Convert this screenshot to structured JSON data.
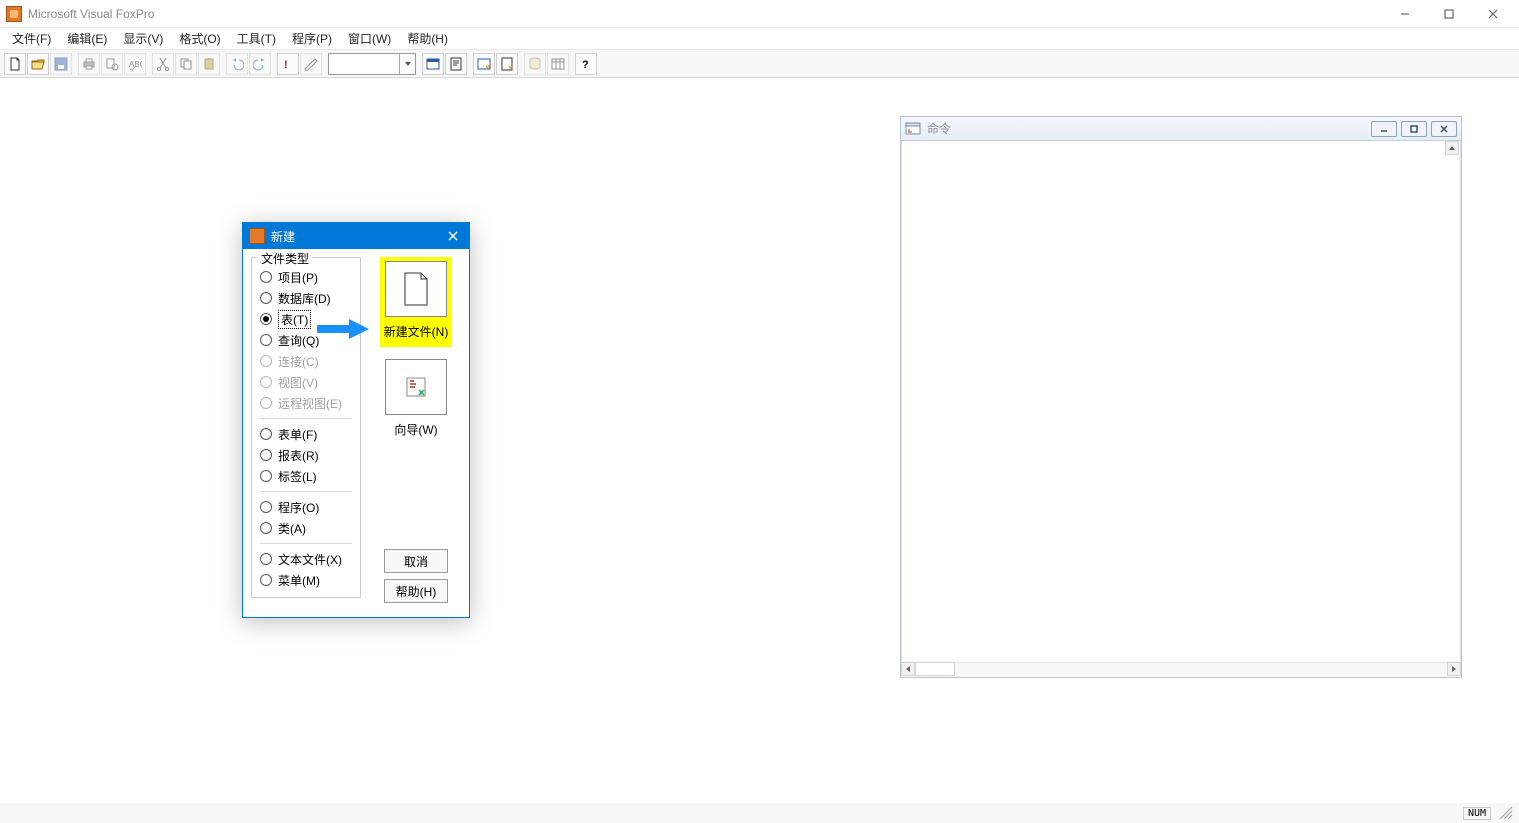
{
  "app": {
    "title": "Microsoft Visual FoxPro"
  },
  "menu": {
    "items": [
      "文件(F)",
      "编辑(E)",
      "显示(V)",
      "格式(O)",
      "工具(T)",
      "程序(P)",
      "窗口(W)",
      "帮助(H)"
    ]
  },
  "toolbar": {
    "buttons": [
      {
        "name": "new-file-icon",
        "title": "新建"
      },
      {
        "name": "open-icon",
        "title": "打开"
      },
      {
        "name": "save-icon",
        "title": "保存",
        "disabled": true
      },
      {
        "sep": true
      },
      {
        "name": "print-icon",
        "title": "打印",
        "disabled": true
      },
      {
        "name": "print-preview-icon",
        "title": "打印预览",
        "disabled": true
      },
      {
        "name": "spell-check-icon",
        "title": "拼写",
        "disabled": true
      },
      {
        "sep": true
      },
      {
        "name": "cut-icon",
        "title": "剪切",
        "disabled": true
      },
      {
        "name": "copy-icon",
        "title": "复制",
        "disabled": true
      },
      {
        "name": "paste-icon",
        "title": "粘贴",
        "disabled": true
      },
      {
        "sep": true
      },
      {
        "name": "undo-icon",
        "title": "撤销",
        "disabled": true
      },
      {
        "name": "redo-icon",
        "title": "重做",
        "disabled": true
      },
      {
        "sep": true
      },
      {
        "name": "run-icon",
        "title": "运行"
      },
      {
        "name": "modify-icon",
        "title": "修改",
        "disabled": true
      },
      {
        "sep": true
      },
      {
        "combo": true,
        "value": ""
      },
      {
        "sep": true
      },
      {
        "name": "form-icon",
        "title": "表单"
      },
      {
        "name": "report-icon",
        "title": "报表"
      },
      {
        "sep": true
      },
      {
        "name": "autoform-icon",
        "title": "自动表单"
      },
      {
        "name": "autoreport-icon",
        "title": "自动报表"
      },
      {
        "sep": true
      },
      {
        "name": "db-designer-icon",
        "title": "数据库设计器",
        "disabled": true
      },
      {
        "name": "table-designer-icon",
        "title": "表设计器",
        "disabled": true
      },
      {
        "sep": true
      },
      {
        "name": "help-icon",
        "title": "帮助"
      }
    ]
  },
  "command_window": {
    "title": "命令"
  },
  "new_dialog": {
    "title": "新建",
    "group_label": "文件类型",
    "options": [
      {
        "label": "项目(P)",
        "selected": false,
        "disabled": false
      },
      {
        "label": "数据库(D)",
        "selected": false,
        "disabled": false
      },
      {
        "label": "表(T)",
        "selected": true,
        "disabled": false
      },
      {
        "label": "查询(Q)",
        "selected": false,
        "disabled": false
      },
      {
        "label": "连接(C)",
        "selected": false,
        "disabled": true
      },
      {
        "label": "视图(V)",
        "selected": false,
        "disabled": true
      },
      {
        "label": "远程视图(E)",
        "selected": false,
        "disabled": true
      },
      {
        "sep": true
      },
      {
        "label": "表单(F)",
        "selected": false,
        "disabled": false
      },
      {
        "label": "报表(R)",
        "selected": false,
        "disabled": false
      },
      {
        "label": "标签(L)",
        "selected": false,
        "disabled": false
      },
      {
        "sep": true
      },
      {
        "label": "程序(O)",
        "selected": false,
        "disabled": false
      },
      {
        "label": "类(A)",
        "selected": false,
        "disabled": false
      },
      {
        "sep": true
      },
      {
        "label": "文本文件(X)",
        "selected": false,
        "disabled": false
      },
      {
        "label": "菜单(M)",
        "selected": false,
        "disabled": false
      }
    ],
    "new_file_button": "新建文件(N)",
    "wizard_button": "向导(W)",
    "cancel_button": "取消",
    "help_button": "帮助(H)"
  },
  "statusbar": {
    "num": "NUM"
  }
}
